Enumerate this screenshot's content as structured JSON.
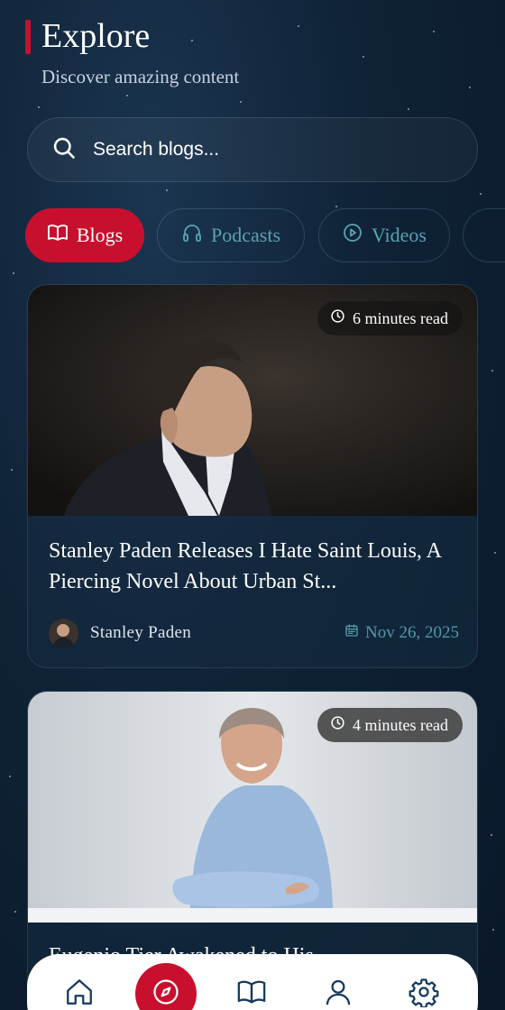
{
  "header": {
    "title": "Explore",
    "subtitle": "Discover amazing content"
  },
  "search": {
    "placeholder": "Search blogs...",
    "icon": "search-icon"
  },
  "tabs": [
    {
      "label": "Blogs",
      "icon": "book-open-icon",
      "active": true
    },
    {
      "label": "Podcasts",
      "icon": "headphones-icon",
      "active": false
    },
    {
      "label": "Videos",
      "icon": "play-circle-icon",
      "active": false
    }
  ],
  "posts": [
    {
      "read_time": "6 minutes read",
      "title": "Stanley Paden Releases I Hate Saint Louis, A Piercing Novel About Urban St...",
      "author": "Stanley Paden",
      "date": "Nov 26, 2025"
    },
    {
      "read_time": "4 minutes read",
      "title": "Eugenio Tier Awakened to His..."
    }
  ],
  "bottom_nav": [
    {
      "icon": "home-icon"
    },
    {
      "icon": "compass-icon",
      "active": true
    },
    {
      "icon": "book-open-icon"
    },
    {
      "icon": "user-icon"
    },
    {
      "icon": "gear-icon"
    }
  ],
  "colors": {
    "accent": "#c8102e",
    "teal": "#4f9aa8",
    "background": "#0f2236"
  }
}
